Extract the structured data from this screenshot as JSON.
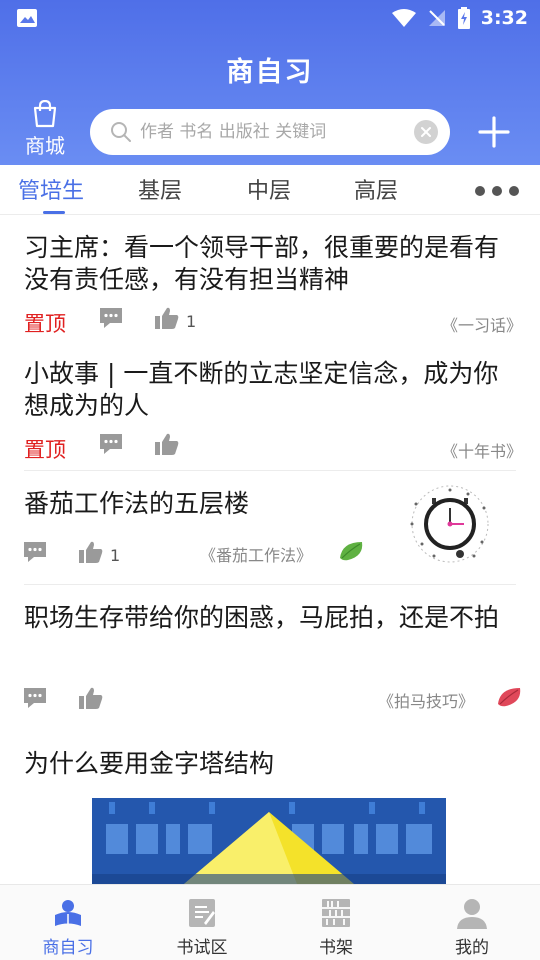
{
  "status_bar": {
    "time": "3:32"
  },
  "header": {
    "title": "商自习",
    "mall_label": "商城",
    "search_placeholder": "作者 书名 出版社 关键词"
  },
  "tabs": [
    {
      "label": "管培生",
      "active": true
    },
    {
      "label": "基层",
      "active": false
    },
    {
      "label": "中层",
      "active": false
    },
    {
      "label": "高层",
      "active": false
    }
  ],
  "feed": [
    {
      "title": "习主席：看一个领导干部，很重要的是看有没有责任感，有没有担当精神",
      "pinned": "置顶",
      "likes": "1",
      "source": "《一习话》"
    },
    {
      "title": "小故事 | 一直不断的立志坚定信念，成为你想成为的人",
      "pinned": "置顶",
      "likes": "",
      "source": "《十年书》"
    },
    {
      "title": "番茄工作法的五层楼",
      "likes": "1",
      "source": "《番茄工作法》"
    },
    {
      "title": "职场生存带给你的困惑，马屁拍，还是不拍",
      "likes": "",
      "source": "《拍马技巧》"
    },
    {
      "title": "为什么要用金字塔结构"
    }
  ],
  "bottom_nav": [
    {
      "label": "商自习",
      "icon": "reader-icon",
      "active": true
    },
    {
      "label": "书试区",
      "icon": "notebook-icon",
      "active": false
    },
    {
      "label": "书架",
      "icon": "bookshelf-icon",
      "active": false
    },
    {
      "label": "我的",
      "icon": "person-icon",
      "active": false
    }
  ],
  "colors": {
    "accent": "#4a70e6",
    "header": "#5b7eee",
    "pin": "#e02020"
  }
}
